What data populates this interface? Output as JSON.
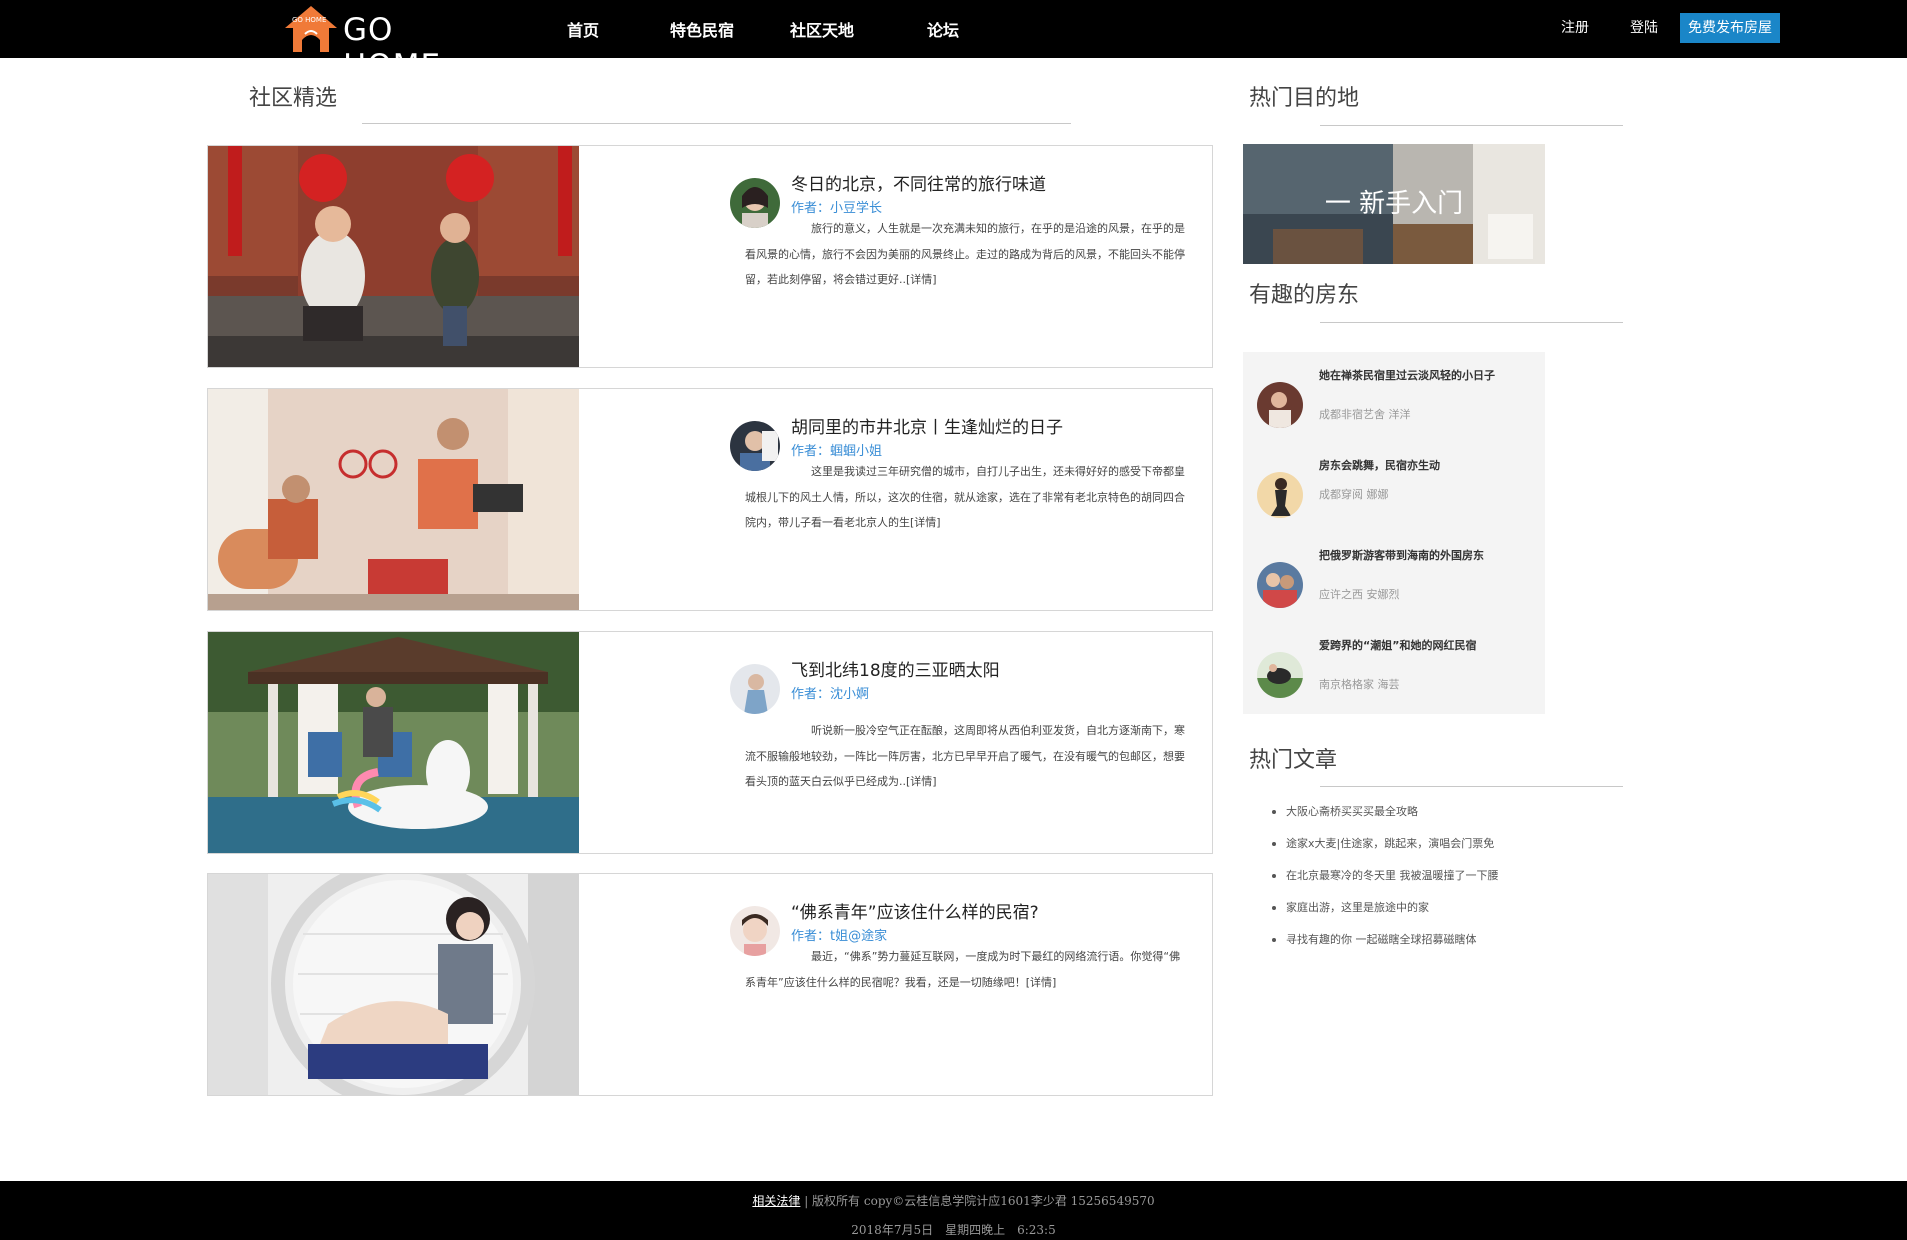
{
  "nav": {
    "logo_text": "GO HOME",
    "logo_badge": "GO HOME",
    "items": [
      {
        "label": "首页"
      },
      {
        "label": "特色民宿"
      },
      {
        "label": "社区天地"
      },
      {
        "label": "论坛"
      }
    ],
    "register": "注册",
    "login": "登陆",
    "publish": "免费发布房屋",
    "accent_color": "#1a86c8"
  },
  "main": {
    "section_title": "社区精选",
    "articles": [
      {
        "title": "冬日的北京，不同往常的旅行味道",
        "author": "作者：小豆学长",
        "excerpt": "旅行的意义，人生就是一次充满未知的旅行，在乎的是沿途的风景，在乎的是看风景的心情，旅行不会因为美丽的风景终止。走过的路成为背后的风景，不能回头不能停留，若此刻停留，将会错过更好..",
        "more": "[详情]"
      },
      {
        "title": "胡同里的市井北京丨生逢灿烂的日子",
        "author": "作者：蝈蝈小姐",
        "excerpt": "这里是我读过三年研究僧的城市，自打儿子出生，还未得好好的感受下帝都皇城根儿下的风土人情，所以，这次的住宿，就从途家，选在了非常有老北京特色的胡同四合院内，带儿子看一看老北京人的生",
        "more": "[详情]"
      },
      {
        "title": "飞到北纬18度的三亚晒太阳",
        "author": "作者：沈小婀",
        "excerpt": "听说新一股冷空气正在酝酿，这周即将从西伯利亚发货，自北方逐渐南下，寒流不服输般地较劲，一阵比一阵厉害，北方已早早开启了暖气，在没有暖气的包邮区，想要看头顶的蓝天白云似乎已经成为..",
        "more": "[详情]"
      },
      {
        "title": "“佛系青年”应该住什么样的民宿?",
        "author": "作者：t姐@途家",
        "excerpt": "最近，“佛系”势力蔓延互联网，一度成为时下最红的网络流行语。你觉得“佛系青年”应该住什么样的民宿呢？我看，还是一切随缘吧！",
        "more": "[详情]"
      }
    ]
  },
  "sidebar": {
    "hot_dest_title": "热门目的地",
    "banner_text": "一 新手入门",
    "hosts_title": "有趣的房东",
    "hosts": [
      {
        "title": "她在禅茶民宿里过云淡风轻的小日子",
        "sub": "成都非宿艺舍 洋洋"
      },
      {
        "title": "房东会跳舞，民宿亦生动",
        "sub": "成都穿阅 娜娜"
      },
      {
        "title": "把俄罗斯游客带到海南的外国房东",
        "sub": "应许之西 安娜烈"
      },
      {
        "title": "爱跨界的“潮姐”和她的网红民宿",
        "sub": "南京格格家 海芸"
      }
    ],
    "hot_articles_title": "热门文章",
    "hot_articles": [
      "大阪心斋桥买买买最全攻略",
      "途家x大麦|住途家，跳起来，演唱会门票免",
      "在北京最寒冷的冬天里 我被温暖撞了一下腰",
      "家庭出游，这里是旅途中的家",
      "寻找有趣的你 一起磁瞎全球招募磁瞎体"
    ]
  },
  "footer": {
    "law_link": "相关法律",
    "copyright": "| 版权所有 copy©云桂信息学院计应1601李少君 15256549570",
    "datetime": "2018年7月5日　星期四晚上　6:23:5"
  }
}
